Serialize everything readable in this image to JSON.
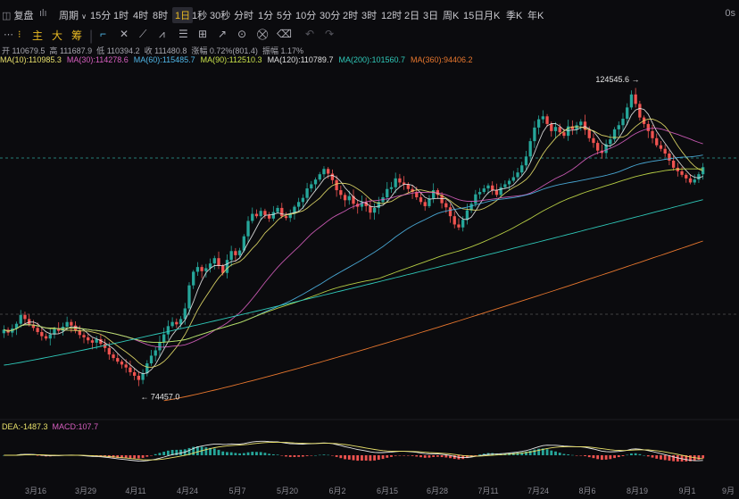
{
  "toolbar": {
    "adjust_label": "复盘",
    "period_label": "周期",
    "intervals": [
      "15分",
      "1时",
      "4时",
      "8时",
      "1日",
      "1秒",
      "30秒",
      "分时",
      "1分",
      "5分",
      "10分",
      "30分",
      "2时",
      "3时",
      "12时",
      "2日",
      "3日",
      "周K",
      "15日",
      "月K",
      "季K",
      "年K"
    ],
    "active_interval": "1日",
    "status": "0s"
  },
  "tools": {
    "main_label": "主",
    "big_label": "大",
    "chip_label": "筹"
  },
  "ohlc": {
    "open_label": "开",
    "open": "110679.5",
    "high_label": "高",
    "high": "111687.9",
    "low_label": "低",
    "low": "110394.2",
    "close_label": "收",
    "close": "111480.8",
    "change_label": "涨幅",
    "change": "0.72%(801.4)",
    "amp_label": "振幅",
    "amp": "1.17%"
  },
  "ma_legend": [
    {
      "text": "MA(10):110985.3",
      "color": "#e8e06a"
    },
    {
      "text": "MA(30):114278.6",
      "color": "#d85fc0"
    },
    {
      "text": "MA(60):115485.7",
      "color": "#4fb7e8"
    },
    {
      "text": "MA(90):112510.3",
      "color": "#c9e24a"
    },
    {
      "text": "MA(120):110789.7",
      "color": "#e0e0e0"
    },
    {
      "text": "MA(200):101560.7",
      "color": "#2fc9b9"
    },
    {
      "text": "MA(360):94406.2",
      "color": "#e8772e"
    }
  ],
  "macd_legend": {
    "dea": "DEA:-1487.3",
    "macd": "MACD:107.7"
  },
  "colors": {
    "up": "#26a69a",
    "down": "#ef5350",
    "ma5": "#e8e8e8",
    "ma10": "#e8e06a",
    "ma30": "#d85fc0",
    "ma60": "#4fb7e8",
    "ma90": "#c9e24a",
    "ma200": "#2fc9b9",
    "ma360": "#e8772e"
  },
  "chart_data": {
    "type": "candlestick",
    "x_ticks": [
      "3月16",
      "3月29",
      "4月11",
      "4月24",
      "5月7",
      "5月20",
      "6月2",
      "6月15",
      "6月28",
      "7月11",
      "7月24",
      "8月6",
      "8月19",
      "9月1",
      "9月"
    ],
    "annotations": [
      {
        "label": "124545.6",
        "type": "high"
      },
      {
        "label": "74457.0",
        "type": "low"
      }
    ],
    "y_range": [
      70000,
      128000
    ],
    "close_series": [
      84000,
      83500,
      84200,
      85000,
      86500,
      85800,
      84900,
      84300,
      83600,
      82900,
      82500,
      83200,
      84100,
      83800,
      84500,
      85300,
      84700,
      83900,
      83100,
      82700,
      82200,
      81800,
      82400,
      81600,
      80900,
      79800,
      79200,
      78600,
      78100,
      77600,
      76800,
      76200,
      75500,
      76600,
      78300,
      79600,
      80500,
      81900,
      83200,
      84600,
      85300,
      84900,
      85800,
      87600,
      91500,
      93800,
      94600,
      93900,
      94400,
      95200,
      96100,
      94800,
      93600,
      95800,
      97300,
      96600,
      97400,
      99800,
      102400,
      103600,
      103200,
      104100,
      103400,
      102800,
      103900,
      104600,
      103200,
      102900,
      103600,
      104800,
      105600,
      106300,
      107900,
      108600,
      109400,
      110300,
      111200,
      110400,
      109300,
      107600,
      106800,
      105900,
      106600,
      105300,
      104800,
      105600,
      104900,
      103800,
      104600,
      105600,
      106400,
      107800,
      108100,
      109600,
      108900,
      108600,
      107800,
      107300,
      106400,
      105600,
      104900,
      106200,
      107600,
      106800,
      105400,
      104700,
      103200,
      101800,
      101300,
      102600,
      104200,
      105300,
      106900,
      107300,
      107900,
      108400,
      107600,
      106800,
      108100,
      108600,
      109200,
      109800,
      110600,
      111800,
      113300,
      115900,
      118200,
      119600,
      120100,
      118800,
      117600,
      118300,
      117400,
      116800,
      118400,
      117900,
      118600,
      119200,
      117800,
      116400,
      115600,
      114300,
      113900,
      115400,
      116200,
      117900,
      118600,
      119700,
      121600,
      123800,
      122200,
      119900,
      118800,
      117600,
      116400,
      115200,
      114600,
      113800,
      112600,
      111400,
      110800,
      110200,
      109600,
      108900,
      109400,
      110300,
      111500
    ]
  }
}
